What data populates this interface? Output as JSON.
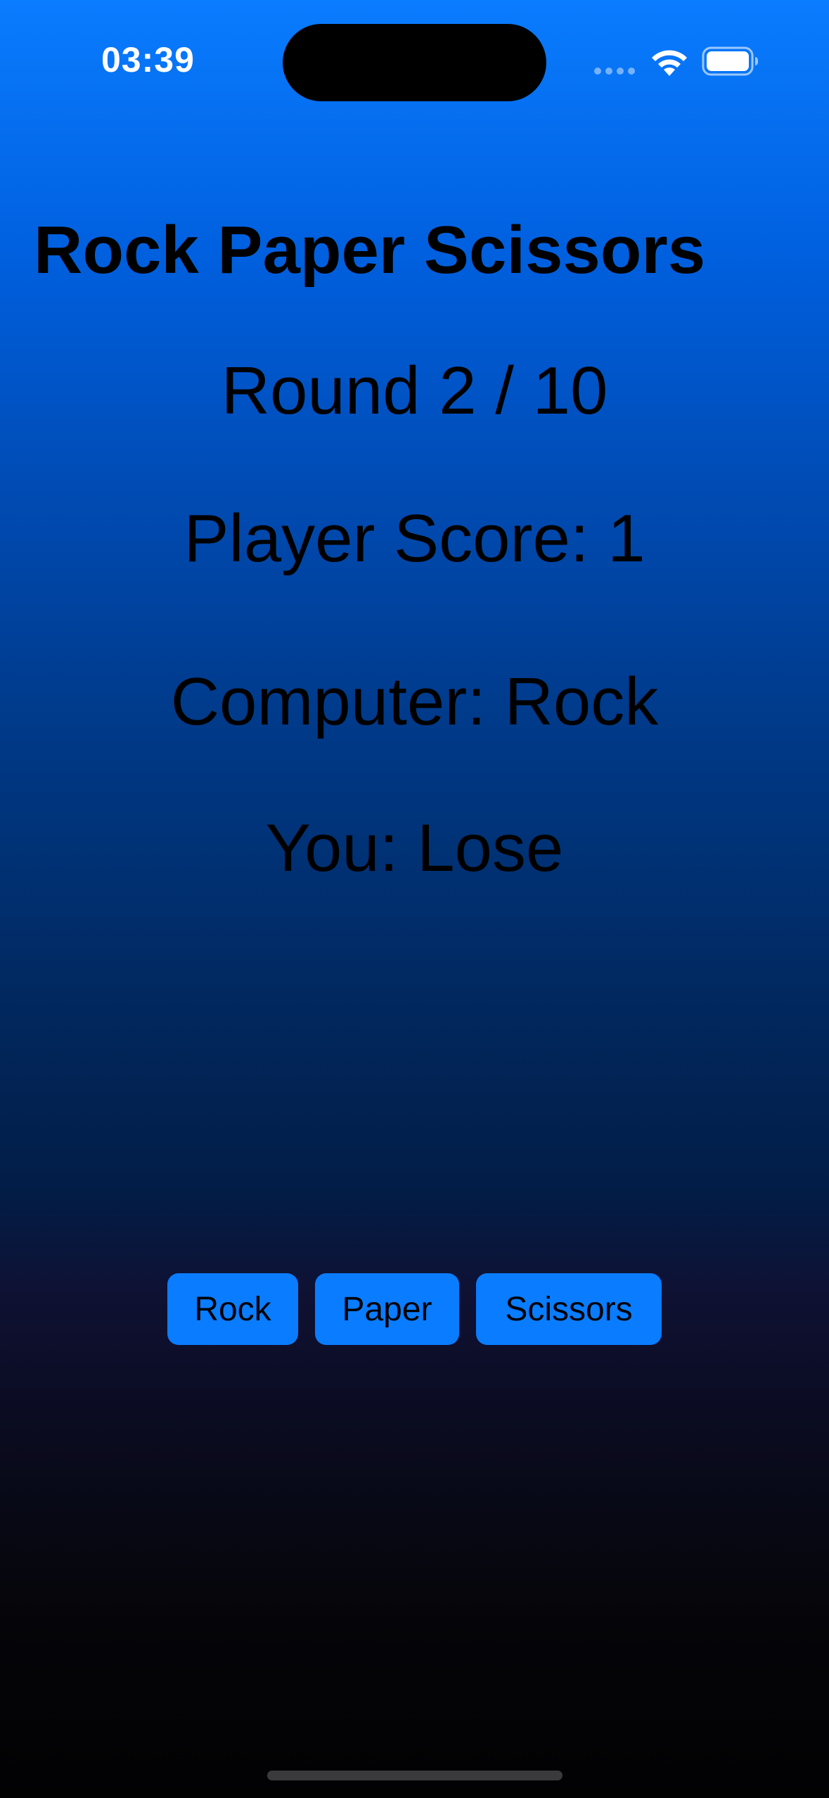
{
  "status_bar": {
    "time": "03:39",
    "signal_icon": "cellular-dots-icon",
    "wifi_icon": "wifi-icon",
    "battery_icon": "battery-icon"
  },
  "game": {
    "title": "Rock Paper Scissors",
    "round_text": "Round 2 / 10",
    "score_text": "Player Score: 1",
    "computer_text": "Computer: Rock",
    "result_text": "You: Lose"
  },
  "choices": {
    "rock_label": "Rock",
    "paper_label": "Paper",
    "scissors_label": "Scissors"
  },
  "colors": {
    "button_accent": "#0a7cff",
    "gradient_top": "#0a7cff",
    "gradient_bottom": "#020203"
  }
}
